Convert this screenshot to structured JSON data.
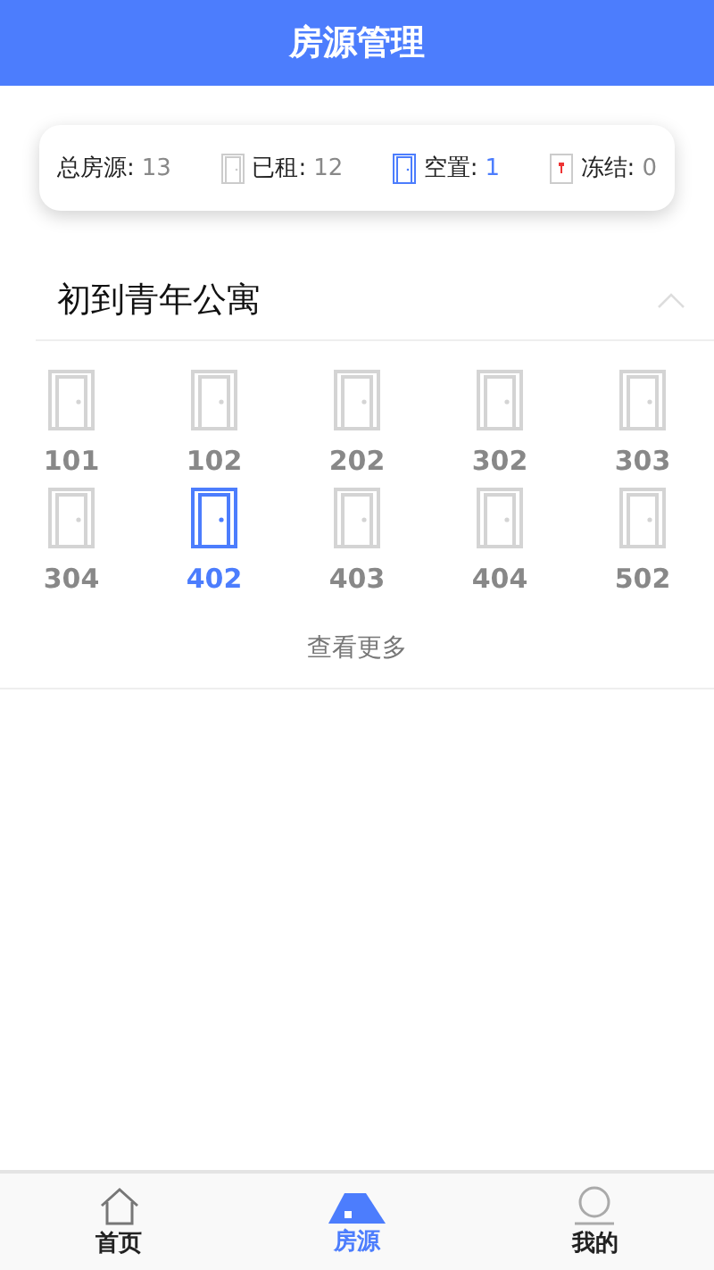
{
  "header": {
    "title": "房源管理"
  },
  "stats": [
    {
      "kind": "total",
      "label": "总房源:",
      "value": "13"
    },
    {
      "kind": "rented",
      "label": "已租:",
      "value": "12"
    },
    {
      "kind": "vacant",
      "label": "空置:",
      "value": "1"
    },
    {
      "kind": "frozen",
      "label": "冻结:",
      "value": "0"
    }
  ],
  "building": {
    "name": "初到青年公寓",
    "expanded": true,
    "rooms": [
      {
        "number": "101",
        "selected": false
      },
      {
        "number": "102",
        "selected": false
      },
      {
        "number": "202",
        "selected": false
      },
      {
        "number": "302",
        "selected": false
      },
      {
        "number": "303",
        "selected": false
      },
      {
        "number": "304",
        "selected": false
      },
      {
        "number": "402",
        "selected": true
      },
      {
        "number": "403",
        "selected": false
      },
      {
        "number": "404",
        "selected": false
      },
      {
        "number": "502",
        "selected": false
      }
    ],
    "more": "查看更多"
  },
  "tabs": [
    {
      "kind": "home",
      "label": "首页",
      "selected": false
    },
    {
      "kind": "house",
      "label": "房源",
      "selected": true
    },
    {
      "kind": "profile",
      "label": "我的",
      "selected": false
    }
  ]
}
